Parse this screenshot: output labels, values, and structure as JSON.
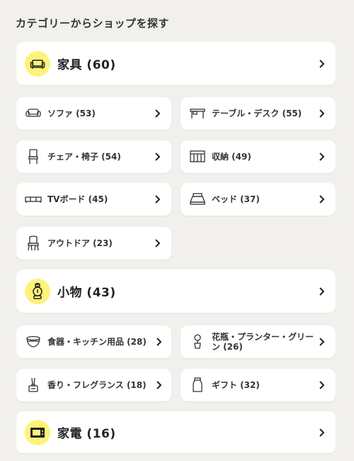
{
  "heading": "カテゴリーからショップを探す",
  "categories": [
    {
      "label": "家具 (60)",
      "icon": "sofa-icon"
    },
    {
      "label": "小物 (43)",
      "icon": "lantern-icon"
    },
    {
      "label": "家電 (16)",
      "icon": "tv-icon"
    }
  ],
  "furniture": [
    {
      "label": "ソファ (53)",
      "icon": "sofa-icon"
    },
    {
      "label": "テーブル・デスク (55)",
      "icon": "table-icon"
    },
    {
      "label": "チェア・椅子 (54)",
      "icon": "chair-icon"
    },
    {
      "label": "収納 (49)",
      "icon": "shelf-icon"
    },
    {
      "label": "TVボード (45)",
      "icon": "tv-board-icon"
    },
    {
      "label": "ベッド (37)",
      "icon": "bed-icon"
    },
    {
      "label": "アウトドア (23)",
      "icon": "outdoor-chair-icon"
    }
  ],
  "goods": [
    {
      "label": "食器・キッチン用品 (28)",
      "icon": "bowl-icon"
    },
    {
      "label": "花瓶・プランター・グリーン (26)",
      "icon": "plant-icon"
    },
    {
      "label": "香り・フレグランス (18)",
      "icon": "diffuser-icon"
    },
    {
      "label": "ギフト (32)",
      "icon": "gift-jar-icon"
    }
  ],
  "colors": {
    "accent": "#fff27a",
    "background": "#f1f0ec",
    "card": "#ffffff"
  }
}
